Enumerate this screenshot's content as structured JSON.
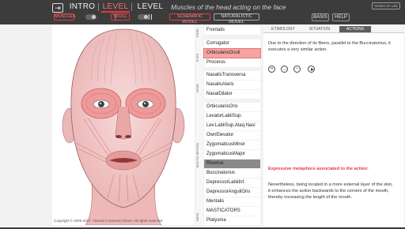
{
  "topbar": {
    "exit_icon": "exit-door-icon",
    "tabs": [
      "INTRO",
      "LEVEL I",
      "LEVEL II"
    ],
    "subtitle": "Muscles of the head acting on the face",
    "terms_label": "TERMS OF USE",
    "layer_muscles": "MUSCLES",
    "layer_skull": "SKULL",
    "model_schematic": "SCHEMATIC MODEL",
    "model_naturalistic": "NATURALISTIC MODEL",
    "basis_label": "BASIS",
    "help_label": "HELP",
    "accent_color": "#e53935"
  },
  "groups": [
    "FORE",
    "EYES",
    "NOSE",
    "MOUTH REGION",
    "NECK"
  ],
  "muscles": [
    "Frontalis",
    "Corrugator",
    "OrbicularisOculi",
    "Procerus",
    "NasalisTransversa",
    "NasalisAlaris",
    "NasalDilator",
    "OrbicularisOris",
    "LevatorLabiiSup.",
    "Lev.LabiiSup.Alaq.Nasi",
    "OwnElevator",
    "ZygomaticusMinor",
    "ZygomaticusMajor",
    "Risorius",
    "Buccinatorius",
    "DepressorLabiiInf.",
    "DepressorAnguliOris",
    "Mentalis",
    "MASTICATORS",
    "Platysma"
  ],
  "selected_muscle": "Risorius",
  "highlighted_muscle": "OrbicularisOculi",
  "info": {
    "tabs": [
      "ETIMOLOGY",
      "SITUATION",
      "ACTIONS"
    ],
    "active_tab": "ACTIONS",
    "action_text": "Due to the direction of its fibers, parallel to the Buccinatorius, it executes a very similar action.",
    "metaphor_title": "Expressive metaphors associated to the action:",
    "metaphor_text": "Nevertheless, being located in a more external layer of the skin, it enhances the action backwards to the corners of the mouth, thereby increasing the length of the mouth.",
    "icons": [
      "smiley-neutral-icon",
      "smiley-happy-icon",
      "smiley-smile-icon",
      "play-icon"
    ]
  },
  "copyright": "Copyright © 2005-2017. Victoria Contreras Flores. All rights reserved."
}
